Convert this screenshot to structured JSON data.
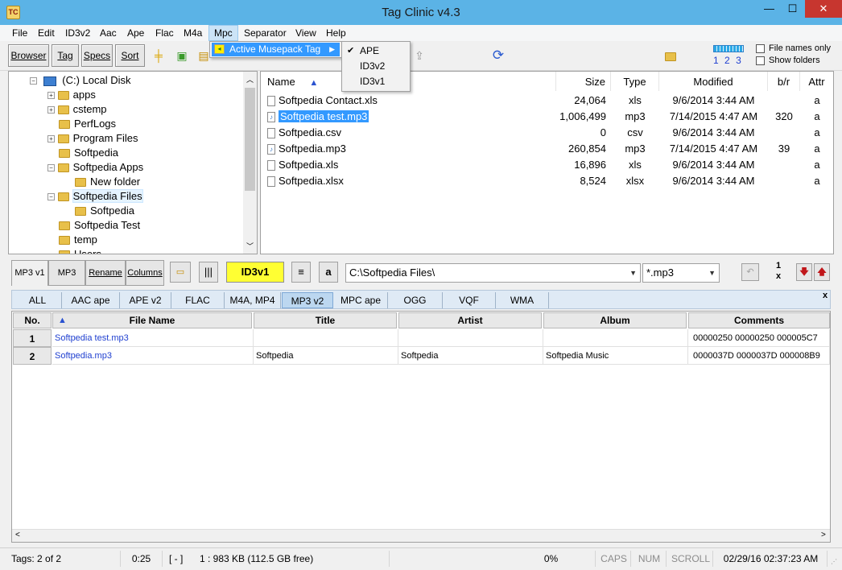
{
  "window": {
    "title": "Tag Clinic v4.3",
    "icon": "TC",
    "minimize": "—",
    "maximize": "☐",
    "close": "✕"
  },
  "menubar": [
    "File",
    "Edit",
    "ID3v2",
    "Aac",
    "Ape",
    "Flac",
    "M4a",
    "Mpc",
    "Separator",
    "View",
    "Help"
  ],
  "mpc_menu": {
    "item": "Active Musepack Tag",
    "submenu": [
      "APE",
      "ID3v2",
      "ID3v1"
    ],
    "checked": "APE"
  },
  "toolbar": {
    "buttons": [
      "Browser",
      "Tag",
      "Specs",
      "Sort"
    ],
    "page_links": [
      "1",
      "2",
      "3"
    ],
    "checkbox_filenames": "File names only",
    "checkbox_folders": "Show folders"
  },
  "tree": {
    "root": "(C:)  Local Disk",
    "items": [
      "apps",
      "cstemp",
      "PerfLogs",
      "Program Files",
      "Softpedia",
      "Softpedia Apps",
      "New folder",
      "Softpedia Files",
      "Softpedia",
      "Softpedia Test",
      "temp",
      "Users"
    ]
  },
  "filelist": {
    "headers": {
      "name": "Name",
      "size": "Size",
      "type": "Type",
      "modified": "Modified",
      "br": "b/r",
      "attr": "Attr"
    },
    "rows": [
      {
        "name": "Softpedia Contact.xls",
        "size": "24,064",
        "type": "xls",
        "modified": "9/6/2014 3:44 AM",
        "br": "",
        "attr": "a"
      },
      {
        "name": "Softpedia test.mp3",
        "size": "1,006,499",
        "type": "mp3",
        "modified": "7/14/2015 4:47 AM",
        "br": "320",
        "attr": "a"
      },
      {
        "name": "Softpedia.csv",
        "size": "0",
        "type": "csv",
        "modified": "9/6/2014 3:44 AM",
        "br": "",
        "attr": "a"
      },
      {
        "name": "Softpedia.mp3",
        "size": "260,854",
        "type": "mp3",
        "modified": "7/14/2015 4:47 AM",
        "br": "39",
        "attr": "a"
      },
      {
        "name": "Softpedia.xls",
        "size": "16,896",
        "type": "xls",
        "modified": "9/6/2014 3:44 AM",
        "br": "",
        "attr": "a"
      },
      {
        "name": "Softpedia.xlsx",
        "size": "8,524",
        "type": "xlsx",
        "modified": "9/6/2014 3:44 AM",
        "br": "",
        "attr": "a"
      }
    ]
  },
  "bottom_tools": {
    "tabs": [
      "MP3 v1",
      "MP3",
      "Rename",
      "Columns"
    ],
    "id3v1_button": "ID3v1",
    "a_button": "a",
    "path": "C:\\Softpedia Files\\",
    "filter": "*.mp3",
    "counter_top": "1",
    "counter_bottom": "x"
  },
  "tag_tabs": [
    "ALL",
    "AAC ape",
    "APE v2",
    "FLAC",
    "M4A, MP4",
    "MP3 v2",
    "MPC ape",
    "OGG",
    "VQF",
    "WMA"
  ],
  "tag_tabs_close": "x",
  "grid": {
    "headers": {
      "no": "No.",
      "file_name": "File Name",
      "title": "Title",
      "artist": "Artist",
      "album": "Album",
      "comments": "Comments"
    },
    "rows": [
      {
        "no": "1",
        "file_name": "Softpedia test.mp3",
        "title": "",
        "artist": "",
        "album": "",
        "comments": "00000250 00000250 000005C7"
      },
      {
        "no": "2",
        "file_name": "Softpedia.mp3",
        "title": "Softpedia",
        "artist": "Softpedia",
        "album": "Softpedia Music",
        "comments": "0000037D 0000037D 000008B9"
      }
    ]
  },
  "statusbar": {
    "tags": "Tags: 2 of 2",
    "time": "0:25",
    "bracket": "[  -  ]",
    "selection": "1  :  983 KB  (112.5 GB free)",
    "percent": "0%",
    "caps": "CAPS",
    "num": "NUM",
    "scroll": "SCROLL",
    "datetime": "02/29/16 02:37:23 AM"
  },
  "colors": {
    "titlebar": "#5bb3e6",
    "highlight": "#3399ff",
    "id3v1_button": "#ffff33",
    "link": "#1f3fd0"
  }
}
